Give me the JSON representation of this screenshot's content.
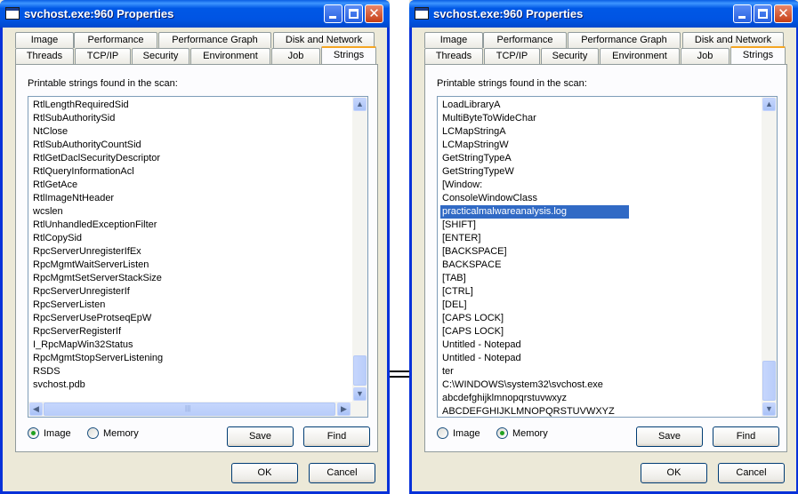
{
  "left_window": {
    "title": "svchost.exe:960 Properties",
    "tabs_row1": [
      "Image",
      "Performance",
      "Performance Graph",
      "Disk and Network"
    ],
    "tabs_row2": [
      "Threads",
      "TCP/IP",
      "Security",
      "Environment",
      "Job",
      "Strings"
    ],
    "active_tab": "Strings",
    "caption": "Printable strings found in the scan:",
    "strings": [
      "RtlLengthRequiredSid",
      "RtlSubAuthoritySid",
      "NtClose",
      "RtlSubAuthorityCountSid",
      "RtlGetDaclSecurityDescriptor",
      "RtlQueryInformationAcl",
      "RtlGetAce",
      "RtlImageNtHeader",
      "wcslen",
      "RtlUnhandledExceptionFilter",
      "RtlCopySid",
      "RpcServerUnregisterIfEx",
      "RpcMgmtWaitServerListen",
      "RpcMgmtSetServerStackSize",
      "RpcServerUnregisterIf",
      "RpcServerListen",
      "RpcServerUseProtseqEpW",
      "RpcServerRegisterIf",
      "I_RpcMapWin32Status",
      "RpcMgmtStopServerListening",
      "RSDS",
      "svchost.pdb"
    ],
    "selected_index": -1,
    "radio_image": "Image",
    "radio_memory": "Memory",
    "radio_selected": "Image",
    "save_label": "Save",
    "find_label": "Find",
    "ok_label": "OK",
    "cancel_label": "Cancel"
  },
  "right_window": {
    "title": "svchost.exe:960 Properties",
    "tabs_row1": [
      "Image",
      "Performance",
      "Performance Graph",
      "Disk and Network"
    ],
    "tabs_row2": [
      "Threads",
      "TCP/IP",
      "Security",
      "Environment",
      "Job",
      "Strings"
    ],
    "active_tab": "Strings",
    "caption": "Printable strings found in the scan:",
    "strings": [
      "LoadLibraryA",
      "MultiByteToWideChar",
      "LCMapStringA",
      "LCMapStringW",
      "GetStringTypeA",
      "GetStringTypeW",
      "[Window:",
      "ConsoleWindowClass",
      "practicalmalwareanalysis.log",
      "[SHIFT]",
      "[ENTER]",
      "[BACKSPACE]",
      "BACKSPACE",
      "[TAB]",
      "[CTRL]",
      "[DEL]",
      "[CAPS LOCK]",
      "[CAPS LOCK]",
      "Untitled - Notepad",
      "Untitled - Notepad",
      "ter",
      "C:\\WINDOWS\\system32\\svchost.exe",
      "abcdefghijklmnopqrstuvwxyz",
      "ABCDEFGHIJKLMNOPQRSTUVWXYZ"
    ],
    "selected_index": 8,
    "radio_image": "Image",
    "radio_memory": "Memory",
    "radio_selected": "Memory",
    "save_label": "Save",
    "find_label": "Find",
    "ok_label": "OK",
    "cancel_label": "Cancel"
  },
  "colors": {
    "titlebar": "#0054e3",
    "selection": "#316ac5",
    "tab_accent": "#f5a623"
  }
}
